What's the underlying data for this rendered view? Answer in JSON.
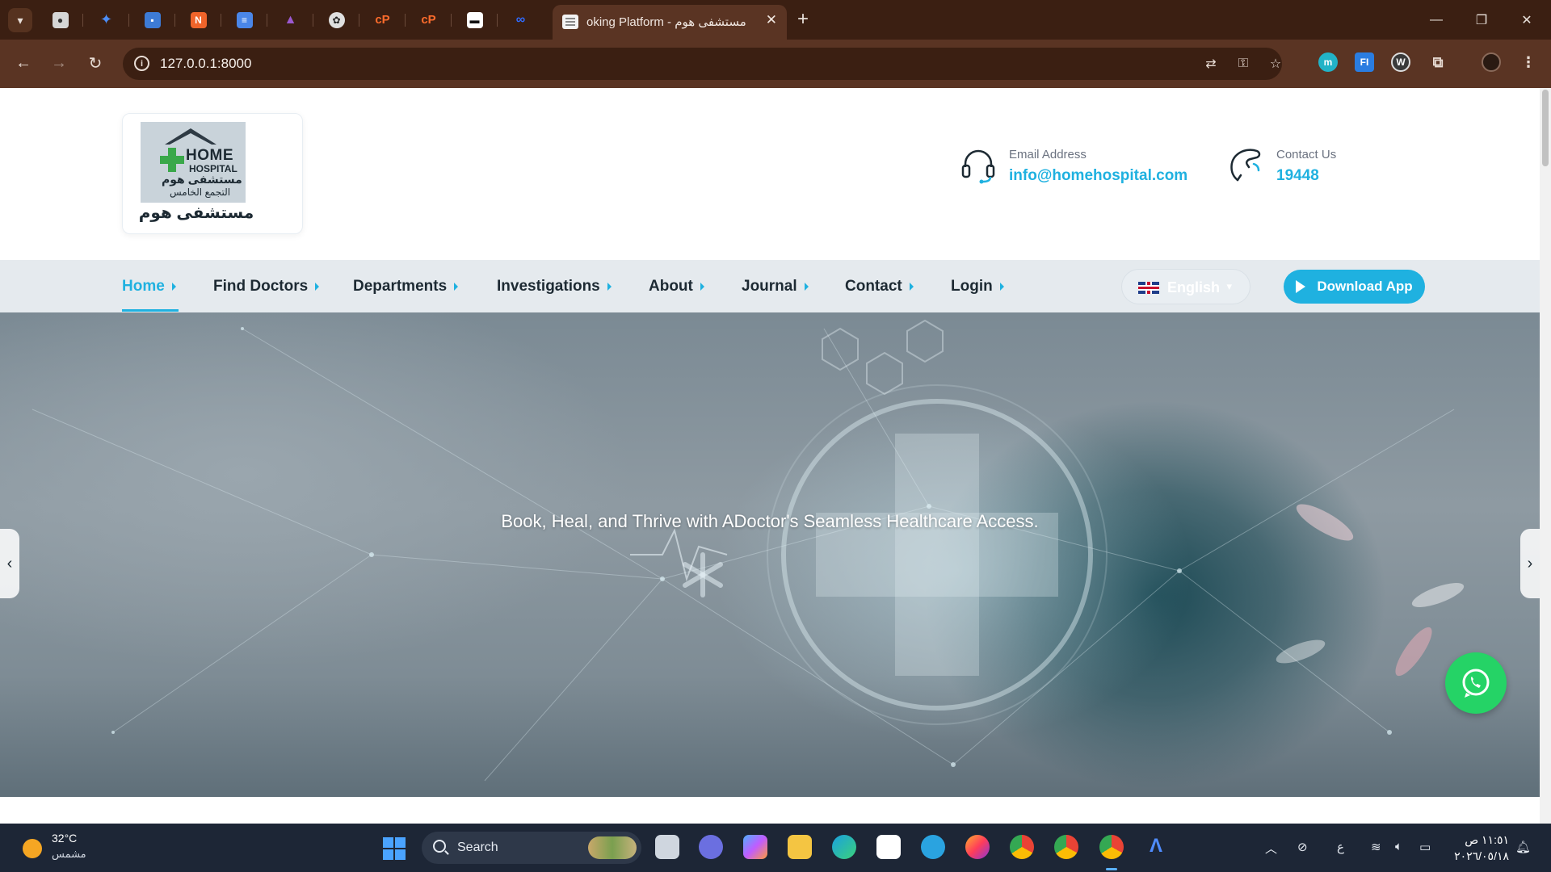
{
  "browser": {
    "active_tab_title": "oking Platform - مستشفى هوم",
    "url": "127.0.0.1:8000",
    "new_tab_symbol": "+",
    "window_controls": [
      "minimize-icon",
      "restore-icon",
      "close-icon"
    ],
    "pinned_tabs": [
      {
        "icon": "tab-favicon-1",
        "color": "#d6d6d6"
      },
      {
        "icon": "gemini-icon",
        "color": "#4c8df6"
      },
      {
        "icon": "tab-favicon-3",
        "color": "#3d7bd6"
      },
      {
        "icon": "tab-favicon-4",
        "color": "#f0642a"
      },
      {
        "icon": "docs-icon",
        "color": "#4a86e8"
      },
      {
        "icon": "tab-favicon-6",
        "color": "#9b59d0"
      },
      {
        "icon": "openai-icon",
        "color": "#e0e0e0"
      },
      {
        "icon": "cpanel-icon",
        "color": "#ff6c2c"
      },
      {
        "icon": "cpanel-icon",
        "color": "#ff6c2c"
      },
      {
        "icon": "tab-favicon-10",
        "color": "#ffffff"
      },
      {
        "icon": "infinity-icon",
        "color": "#2f6bff"
      }
    ],
    "extensions": [
      {
        "name": "extension-m-icon",
        "label": "m",
        "color": "#22b3c7"
      },
      {
        "name": "extension-fi-icon",
        "label": "FI",
        "color": "#2a7de1"
      },
      {
        "name": "extension-w-icon",
        "label": "W",
        "color": "#3a3a3a"
      }
    ]
  },
  "site": {
    "logo": {
      "line1": "HOME",
      "line2": "HOSPITAL",
      "line3": "مستشفى هوم",
      "line4": "التجمع الخامس",
      "caption": "مستشفى هوم"
    },
    "contacts": [
      {
        "label": "Email Address",
        "value": "info@homehospital.com",
        "icon": "headset-icon"
      },
      {
        "label": "Contact Us",
        "value": "19448",
        "icon": "phone-icon"
      }
    ],
    "nav": [
      {
        "label": "Home",
        "active": true
      },
      {
        "label": "Find Doctors",
        "active": false
      },
      {
        "label": "Departments",
        "active": false
      },
      {
        "label": "Investigations",
        "active": false
      },
      {
        "label": "About",
        "active": false
      },
      {
        "label": "Journal",
        "active": false
      },
      {
        "label": "Contact",
        "active": false
      },
      {
        "label": "Login",
        "active": false
      }
    ],
    "language": {
      "selected": "English",
      "flag": "uk-flag-icon"
    },
    "download_app_label": "Download App",
    "hero_text": "Book, Heal, and Thrive with ADoctor's Seamless Healthcare Access.",
    "accent_color": "#1fb1e0",
    "whatsapp_color": "#25d366"
  },
  "taskbar": {
    "weather_temp": "32°C",
    "weather_desc": "مشمس",
    "search_label": "Search",
    "input_indicator": "ع",
    "time": "١١:٥١ ص",
    "date": "٢٠٢٦/٠٥/١٨",
    "apps": [
      {
        "name": "task-view-icon",
        "color": "#cfd6df"
      },
      {
        "name": "teams-icon",
        "color": "#6b6fe0"
      },
      {
        "name": "copilot-icon",
        "color": "#4fb0ff"
      },
      {
        "name": "file-explorer-icon",
        "color": "#f4c542"
      },
      {
        "name": "edge-icon",
        "color": "#1aa0e0"
      },
      {
        "name": "store-icon",
        "color": "#f25022"
      },
      {
        "name": "telegram-icon",
        "color": "#2aa3e0"
      },
      {
        "name": "firefox-icon",
        "color": "#ff6a2f"
      },
      {
        "name": "chrome-icon",
        "color": "#34a853"
      },
      {
        "name": "chrome-profile-icon",
        "color": "#34a853"
      },
      {
        "name": "chrome-active-icon",
        "color": "#ea4335"
      },
      {
        "name": "app-a-icon",
        "color": "#4f8cff"
      }
    ]
  }
}
